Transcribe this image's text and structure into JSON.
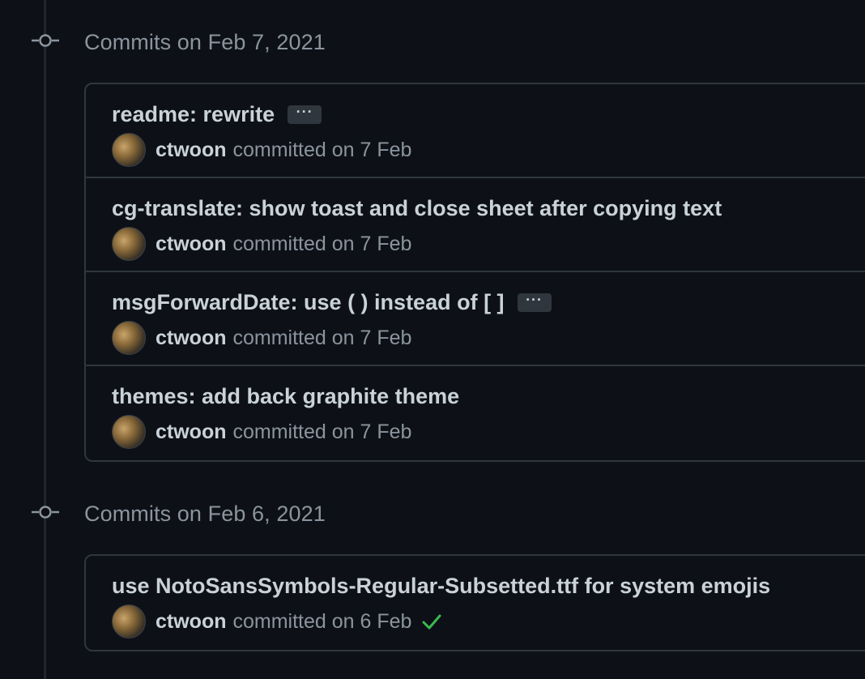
{
  "groups": [
    {
      "title": "Commits on Feb 7, 2021",
      "commits": [
        {
          "title": "readme: rewrite",
          "has_ellipsis": true,
          "ellipsis": "···",
          "author": "ctwoon",
          "committed": "committed on 7 Feb",
          "verified": false
        },
        {
          "title": "cg-translate: show toast and close sheet after copying text",
          "has_ellipsis": false,
          "author": "ctwoon",
          "committed": "committed on 7 Feb",
          "verified": false
        },
        {
          "title": "msgForwardDate: use ( ) instead of [ ]",
          "has_ellipsis": true,
          "ellipsis": "···",
          "author": "ctwoon",
          "committed": "committed on 7 Feb",
          "verified": false
        },
        {
          "title": "themes: add back graphite theme",
          "has_ellipsis": false,
          "author": "ctwoon",
          "committed": "committed on 7 Feb",
          "verified": false
        }
      ]
    },
    {
      "title": "Commits on Feb 6, 2021",
      "commits": [
        {
          "title": "use NotoSansSymbols-Regular-Subsetted.ttf for system emojis",
          "has_ellipsis": false,
          "author": "ctwoon",
          "committed": "committed on 6 Feb",
          "verified": true
        }
      ]
    }
  ],
  "colors": {
    "background": "#0d1117",
    "border": "#30363d",
    "text_primary": "#c9d1d9",
    "text_muted": "#8b949e",
    "success": "#3fb950"
  }
}
